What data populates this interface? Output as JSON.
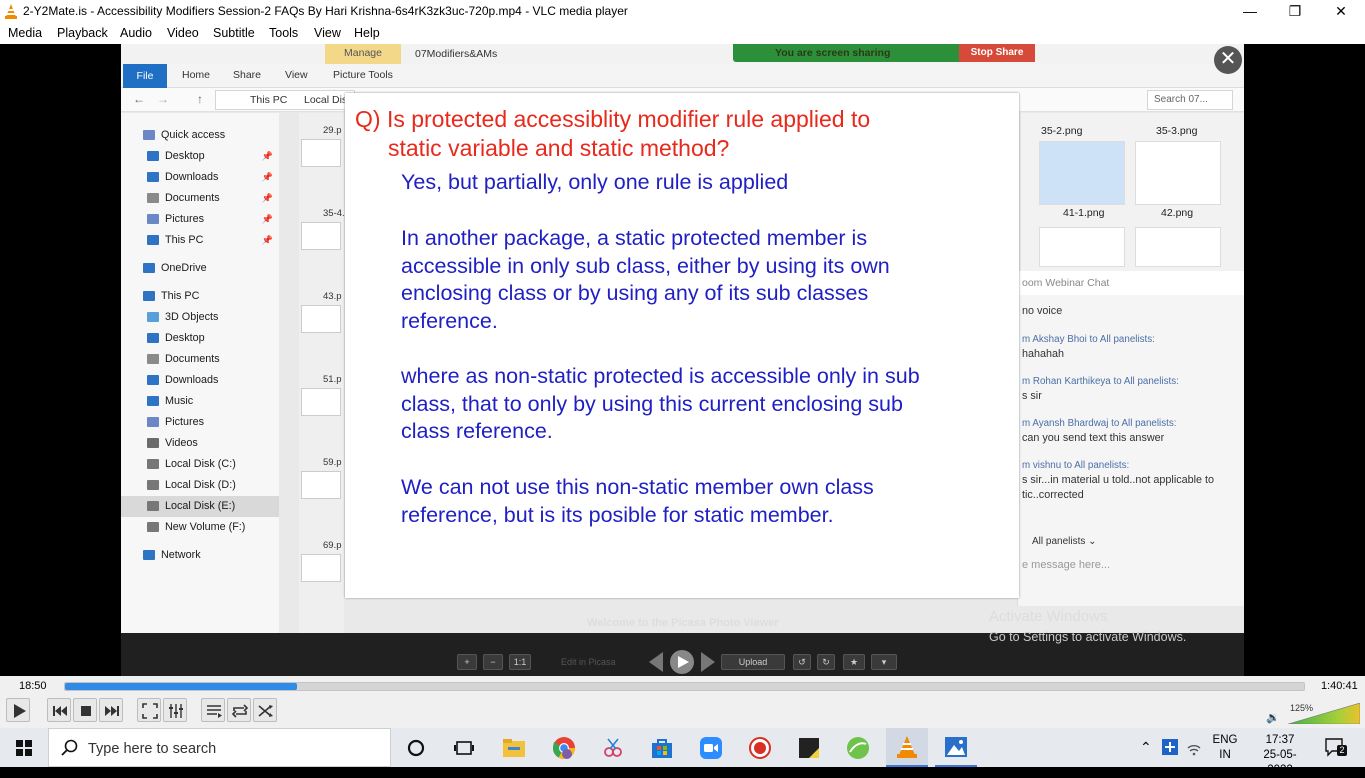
{
  "window": {
    "title": "2-Y2Mate.is - Accessibility Modifiers  Session-2  FAQs  By Hari Krishna-6s4rK3zk3uc-720p.mp4 - VLC media player",
    "minimize": "—",
    "maximize": "❐",
    "close": "✕"
  },
  "menu": [
    "Media",
    "Playback",
    "Audio",
    "Video",
    "Subtitle",
    "Tools",
    "View",
    "Help"
  ],
  "explorer": {
    "ribbon_tabs": [
      "File",
      "Home",
      "Share",
      "View",
      "Picture Tools"
    ],
    "manage_tab": "Manage",
    "folder_title": "07Modifiers&AMs",
    "breadcrumb": [
      "This PC",
      "Local Dis"
    ],
    "search_placeholder": "Search 07...",
    "nav": [
      {
        "label": "Quick access",
        "icon": "star-icon",
        "pinned": false
      },
      {
        "label": "Desktop",
        "icon": "desktop-icon",
        "pinned": true
      },
      {
        "label": "Downloads",
        "icon": "download-icon",
        "pinned": true
      },
      {
        "label": "Documents",
        "icon": "document-icon",
        "pinned": true
      },
      {
        "label": "Pictures",
        "icon": "pictures-icon",
        "pinned": true
      },
      {
        "label": "This PC",
        "icon": "computer-icon",
        "pinned": true
      },
      {
        "label": "OneDrive",
        "icon": "cloud-icon",
        "pinned": false
      },
      {
        "label": "This PC",
        "icon": "computer-icon",
        "pinned": false
      },
      {
        "label": "3D Objects",
        "icon": "cube-icon",
        "pinned": false
      },
      {
        "label": "Desktop",
        "icon": "desktop-icon",
        "pinned": false
      },
      {
        "label": "Documents",
        "icon": "document-icon",
        "pinned": false
      },
      {
        "label": "Downloads",
        "icon": "download-icon",
        "pinned": false
      },
      {
        "label": "Music",
        "icon": "music-icon",
        "pinned": false
      },
      {
        "label": "Pictures",
        "icon": "pictures-icon",
        "pinned": false
      },
      {
        "label": "Videos",
        "icon": "video-icon",
        "pinned": false
      },
      {
        "label": "Local Disk (C:)",
        "icon": "disk-icon",
        "pinned": false
      },
      {
        "label": "Local Disk (D:)",
        "icon": "disk-icon",
        "pinned": false
      },
      {
        "label": "Local Disk (E:)",
        "icon": "disk-icon",
        "pinned": false,
        "selected": true
      },
      {
        "label": "New Volume (F:)",
        "icon": "disk-icon",
        "pinned": false
      },
      {
        "label": "Network",
        "icon": "network-icon",
        "pinned": false
      }
    ],
    "file_labels": [
      "29.p",
      "35-4.",
      "43.p",
      "51.p",
      "59.p",
      "69.p"
    ],
    "thumb_labels": [
      "35-2.png",
      "35-3.png",
      "41-1.png",
      "42.png"
    ]
  },
  "zoom": {
    "sharing_text": "You are screen sharing",
    "stop_share": "Stop Share",
    "close_glyph": "✕",
    "chat_title": "oom Webinar Chat",
    "messages": [
      {
        "from": "",
        "text": "no voice"
      },
      {
        "from": "m Akshay Bhoi to All panelists:",
        "text": "hahahah"
      },
      {
        "from": "m Rohan Karthikeya to All panelists:",
        "text": "s sir"
      },
      {
        "from": "m Ayansh Bhardwaj to All panelists:",
        "text": "can you send text this answer"
      },
      {
        "from": "m vishnu to All panelists:",
        "text": "s sir...in material u told..not applicable to"
      },
      {
        "from": "",
        "text": "tic..corrected"
      }
    ],
    "recipient": "All panelists ⌄",
    "input_placeholder": "e message here..."
  },
  "slide": {
    "question_line1": "Q) Is protected accessiblity modifier rule applied to",
    "question_line2": "static variable and static method?",
    "answer1": "Yes, but  partially,  only one rule is applied",
    "answer2_lines": [
      "In another package, a static protected member is",
      "accessible in only sub class, either by using its own",
      "enclosing class or by using any of its sub classes",
      "reference."
    ],
    "answer3_lines": [
      "where as non-static protected is accessible only in sub",
      "class, that to only by using this current enclosing sub",
      "class reference."
    ],
    "answer4_lines": [
      "We can not use this non-static member own class",
      "reference, but is its posible for static member."
    ]
  },
  "picasa": {
    "welcome": "Welcome to the Picasa Photo Viewer",
    "edit": "Edit in Picasa",
    "upload": "Upload",
    "one_to_one": "1:1"
  },
  "activate": {
    "line1": "Activate Windows",
    "line2": "Go to Settings to activate Windows."
  },
  "player": {
    "elapsed": "18:50",
    "total": "1:40:41",
    "progress_fraction": 0.187,
    "volume_percent": "125%",
    "accent": "#2f8be6"
  },
  "taskbar": {
    "search_placeholder": "Type here to search",
    "lang_line1": "ENG",
    "lang_line2": "IN",
    "time": "17:37",
    "date": "25-05-2022",
    "notifications": "2"
  }
}
